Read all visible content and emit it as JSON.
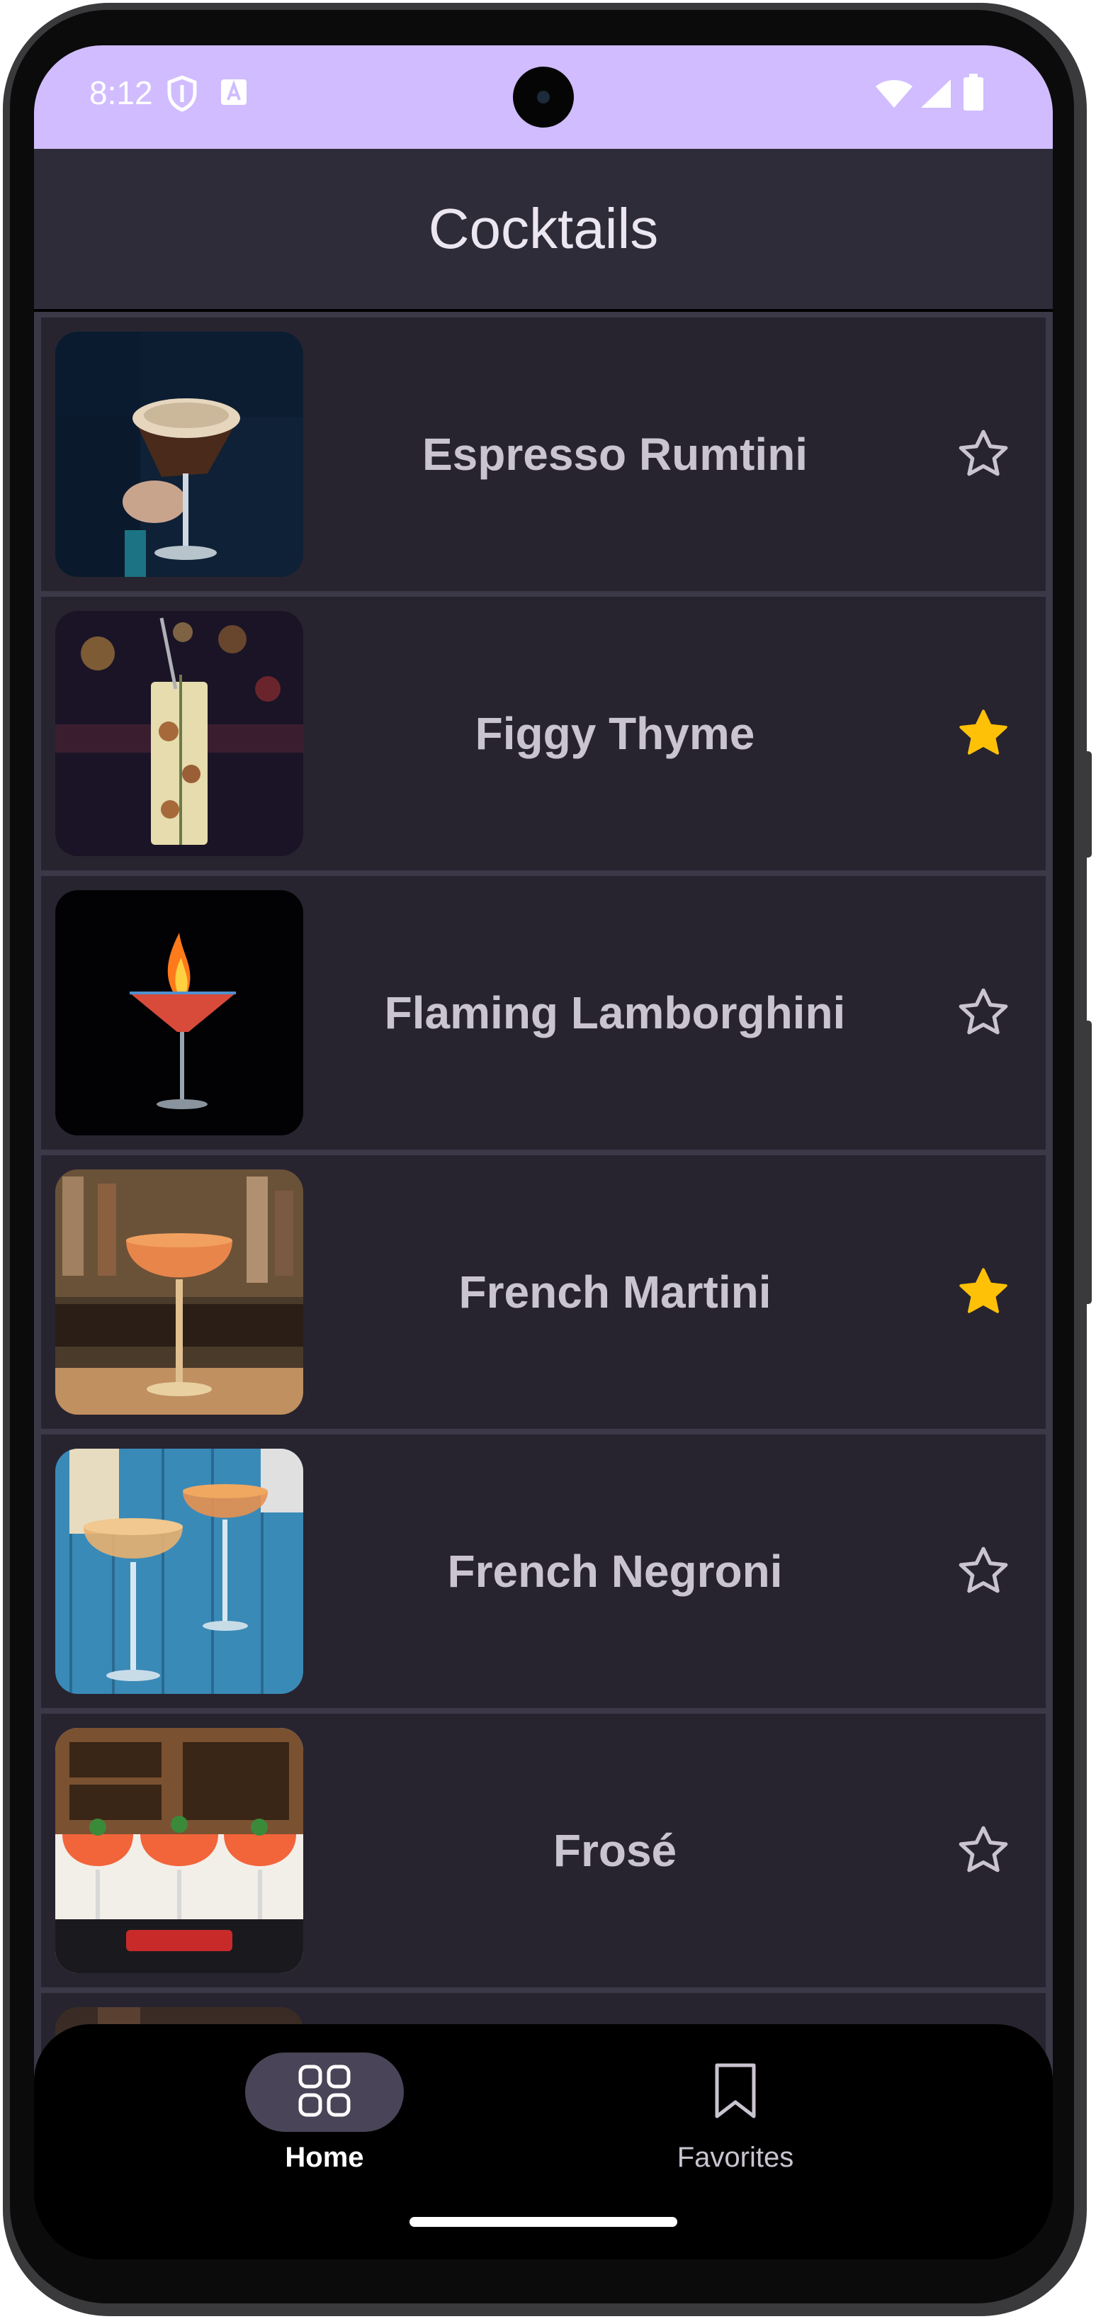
{
  "status_bar": {
    "time": "8:12",
    "left_icons": [
      "shield-icon",
      "font-a-icon"
    ],
    "right_icons": [
      "wifi-icon",
      "signal-icon",
      "battery-icon"
    ],
    "bg_color": "#d0bcff"
  },
  "app_bar": {
    "title": "Cocktails",
    "bg_color": "#2f2c3a"
  },
  "cocktails": [
    {
      "name": "Espresso Rumtini",
      "favorite": false
    },
    {
      "name": "Figgy Thyme",
      "favorite": true
    },
    {
      "name": "Flaming Lamborghini",
      "favorite": false
    },
    {
      "name": "French Martini",
      "favorite": true
    },
    {
      "name": "French Negroni",
      "favorite": false
    },
    {
      "name": "Frosé",
      "favorite": false
    }
  ],
  "bottom_nav": {
    "items": [
      {
        "label": "Home",
        "icon": "grid-icon",
        "active": true
      },
      {
        "label": "Favorites",
        "icon": "bookmark-icon",
        "active": false
      }
    ]
  },
  "colors": {
    "star_filled": "#ffc107",
    "star_outline": "#cac4d0",
    "row_bg": "#272430",
    "nav_pill": "#4a4458"
  }
}
